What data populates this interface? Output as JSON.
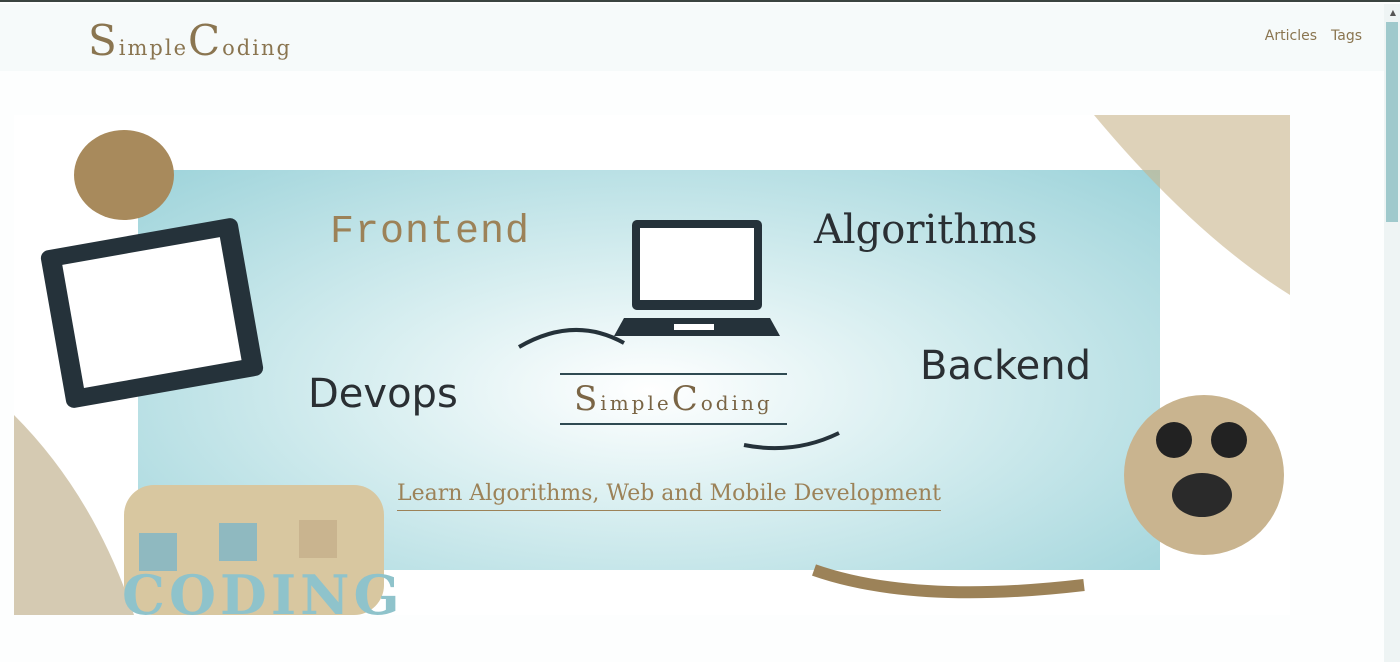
{
  "header": {
    "logo": {
      "s": "S",
      "imple": "imple",
      "c": "C",
      "oding": "oding"
    },
    "nav": [
      "Articles",
      "Tags"
    ]
  },
  "banner": {
    "topics": {
      "frontend": "Frontend",
      "algorithms": "Algorithms",
      "devops": "Devops",
      "backend": "Backend"
    },
    "center_logo": {
      "s": "S",
      "imple": "imple",
      "c": "C",
      "oding": "oding"
    },
    "tagline": "Learn Algorithms, Web and Mobile Development",
    "coding_letters": "CODING"
  },
  "colors": {
    "brand": "#8a7550",
    "teal": "#9dd3da"
  }
}
